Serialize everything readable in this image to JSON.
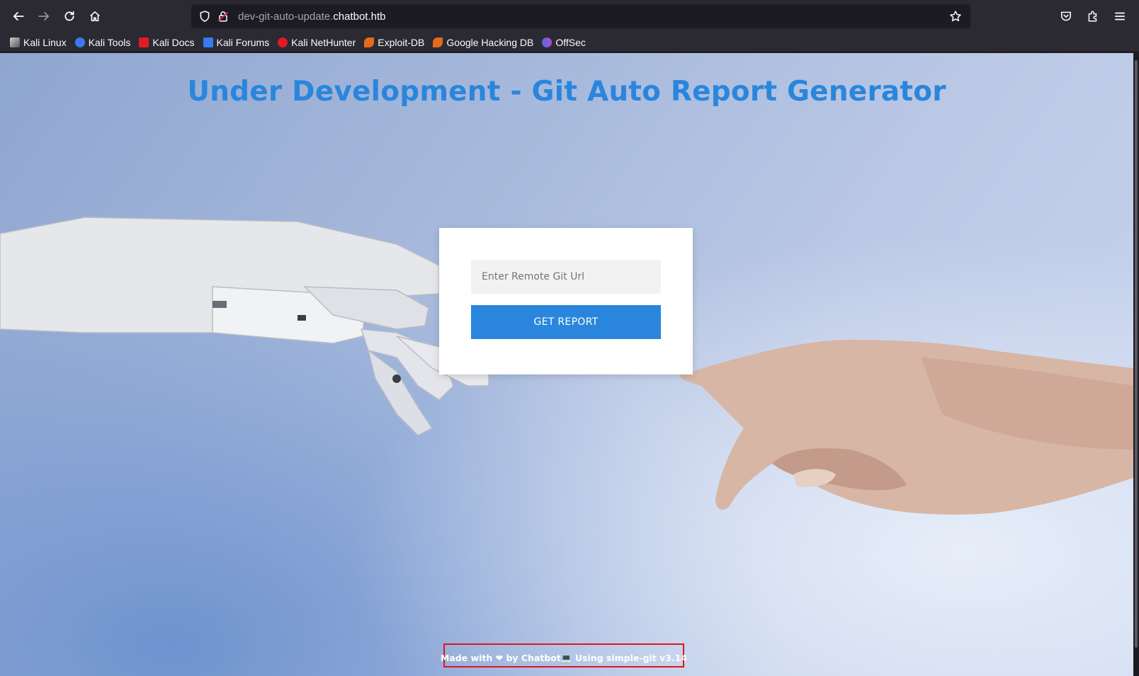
{
  "browser": {
    "url_prefix": "dev-git-auto-update.",
    "url_host": "chatbot.htb",
    "bookmarks": [
      {
        "label": "Kali Linux",
        "icon": "kali-dragon-icon",
        "color": "#1e1e1e"
      },
      {
        "label": "Kali Tools",
        "icon": "kali-tools-icon",
        "color": "#367bf0"
      },
      {
        "label": "Kali Docs",
        "icon": "kali-docs-icon",
        "color": "#e01b24"
      },
      {
        "label": "Kali Forums",
        "icon": "kali-forums-icon",
        "color": "#367bf0"
      },
      {
        "label": "Kali NetHunter",
        "icon": "kali-nethunter-icon",
        "color": "#e01b24"
      },
      {
        "label": "Exploit-DB",
        "icon": "exploit-db-icon",
        "color": "#e66a1c"
      },
      {
        "label": "Google Hacking DB",
        "icon": "ghdb-icon",
        "color": "#e66a1c"
      },
      {
        "label": "OffSec",
        "icon": "offsec-icon",
        "color": "#6b5bd6"
      }
    ]
  },
  "page": {
    "title": "Under Development - Git Auto Report Generator",
    "input_placeholder": "Enter Remote Git Url",
    "button_label": "GET REPORT",
    "footer": "Made with ❤ by Chatbot💻 Using simple-git v3.14",
    "accent_color": "#2a86dc",
    "highlight_color": "#e0161d"
  }
}
